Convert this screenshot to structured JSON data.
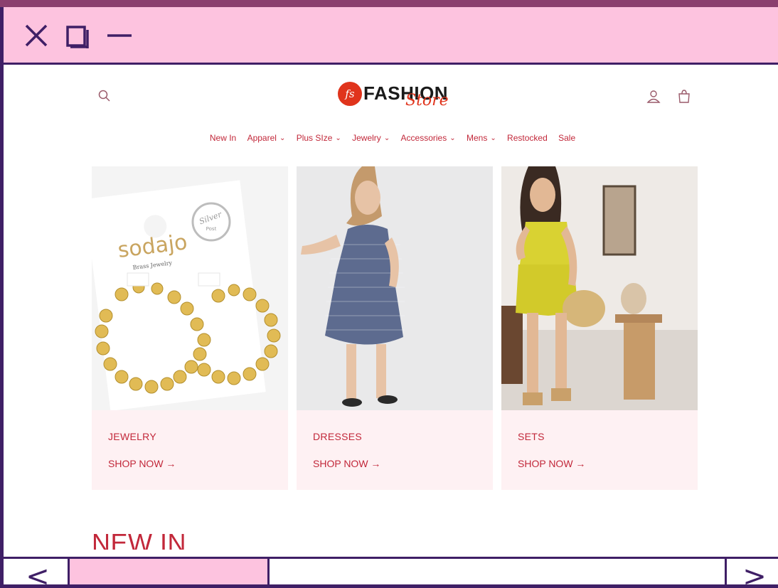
{
  "window": {
    "controls": [
      "close-icon",
      "maximize-icon",
      "minimize-icon"
    ]
  },
  "site": {
    "logo_mark": "fs",
    "logo_main": "FASHION",
    "logo_script": "Store"
  },
  "nav": {
    "items": [
      {
        "label": "New In",
        "dropdown": false
      },
      {
        "label": "Apparel",
        "dropdown": true
      },
      {
        "label": "Plus SIze",
        "dropdown": true
      },
      {
        "label": "Jewelry",
        "dropdown": true
      },
      {
        "label": "Accessories",
        "dropdown": true
      },
      {
        "label": "Mens",
        "dropdown": true
      },
      {
        "label": "Restocked",
        "dropdown": false
      },
      {
        "label": "Sale",
        "dropdown": false
      }
    ]
  },
  "cards": [
    {
      "title": "JEWELRY",
      "link": "SHOP NOW →",
      "brand_text": "sodajo",
      "brand_sub": "Brass Jewelry",
      "badge_top": "Silver",
      "badge_bottom": "Post"
    },
    {
      "title": "DRESSES",
      "link": "SHOP NOW →"
    },
    {
      "title": "SETS",
      "link": "SHOP NOW →"
    }
  ],
  "section": {
    "heading": "NEW IN"
  },
  "bottom_nav": {
    "prev": "<",
    "next": ">"
  },
  "colors": {
    "accent": "#c2283a",
    "frame": "#3f1f66",
    "titlebar": "#fdc3df",
    "card_bg": "#fef1f3",
    "logo_red": "#e0341c"
  }
}
